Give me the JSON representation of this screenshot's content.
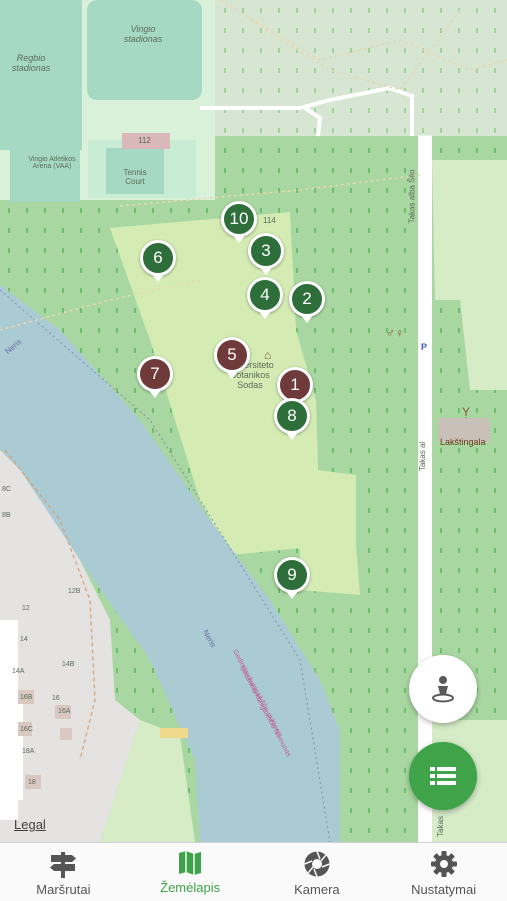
{
  "map": {
    "labels": {
      "vingio_stadionas": "Vingio stadionas",
      "regbio_stadionas": "Regbio stadionas",
      "vingio_arena": "Vingio Atletikos Arena (VAA)",
      "tennis_court": "Tennis Court",
      "num_112": "112",
      "num_114": "114",
      "garden": "Universiteto Botanikos Sodas",
      "lakstingala": "Lakštingala",
      "road_upper": "Takas alba Šilo",
      "road_lower": "Takas al",
      "road_bottom": "Takas",
      "river_1": "Neris",
      "river_2": "Neris",
      "river_3": "Gedimino kunigaikščio dukterys",
      "river_4": "Gedimino kunigaikščio Nemunas",
      "house_12": "12",
      "house_12b": "12B",
      "house_14": "14",
      "house_14a": "14A",
      "house_14b": "14B",
      "house_16": "16",
      "house_16a": "16A",
      "house_16b": "16B",
      "house_16c": "16C",
      "house_18": "18",
      "house_18a": "18A",
      "house_8c": "8C",
      "house_8b": "8B",
      "parking": "P"
    },
    "pins": [
      {
        "label": "10",
        "color": "green"
      },
      {
        "label": "3",
        "color": "green"
      },
      {
        "label": "6",
        "color": "green"
      },
      {
        "label": "4",
        "color": "green"
      },
      {
        "label": "2",
        "color": "green"
      },
      {
        "label": "5",
        "color": "brown"
      },
      {
        "label": "7",
        "color": "brown"
      },
      {
        "label": "1",
        "color": "brown"
      },
      {
        "label": "8",
        "color": "green"
      },
      {
        "label": "9",
        "color": "green"
      }
    ]
  },
  "legal_link": "Legal",
  "fab": {
    "locate_icon": "person-location-icon",
    "list_icon": "list-icon"
  },
  "tabs": [
    {
      "label": "Maršrutai",
      "icon": "signpost-icon",
      "active": false
    },
    {
      "label": "Žemėlapis",
      "icon": "map-icon",
      "active": true
    },
    {
      "label": "Kamera",
      "icon": "camera-aperture-icon",
      "active": false
    },
    {
      "label": "Nustatymai",
      "icon": "gear-icon",
      "active": false
    }
  ],
  "colors": {
    "accent": "#3fa349",
    "pin_green": "#2e6e3a",
    "pin_brown": "#6e3a3a",
    "forest": "#a8d8a0",
    "garden": "#d4ecb4",
    "river": "#aacbd4"
  }
}
